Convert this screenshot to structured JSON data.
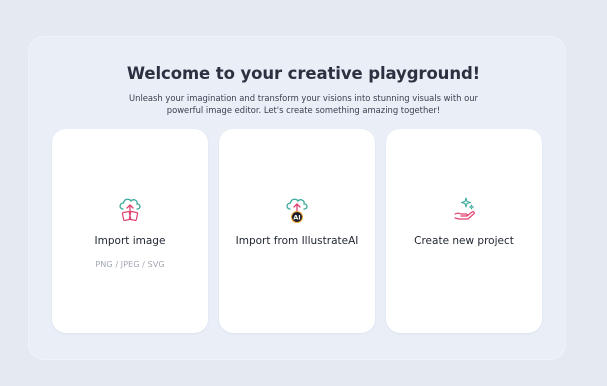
{
  "welcome": {
    "title": "Welcome to your creative playground!",
    "subtitle": "Unleash your imagination and transform your visions into stunning visuals with our powerful image editor. Let's create something amazing together!"
  },
  "cards": [
    {
      "label": "Import image",
      "sublabel": "PNG / JPEG / SVG",
      "icon": "cloud-upload-image-icon"
    },
    {
      "label": "Import from IllustrateAI",
      "icon": "cloud-upload-ai-icon",
      "badge": "AI"
    },
    {
      "label": "Create new project",
      "icon": "hand-sparkle-icon"
    }
  ],
  "colors": {
    "background": "#e4e9f2",
    "panel": "#e9eef7",
    "card": "#ffffff",
    "accent_pink": "#e0426f",
    "accent_teal": "#3aa89a",
    "text_dark": "#1e2430"
  }
}
